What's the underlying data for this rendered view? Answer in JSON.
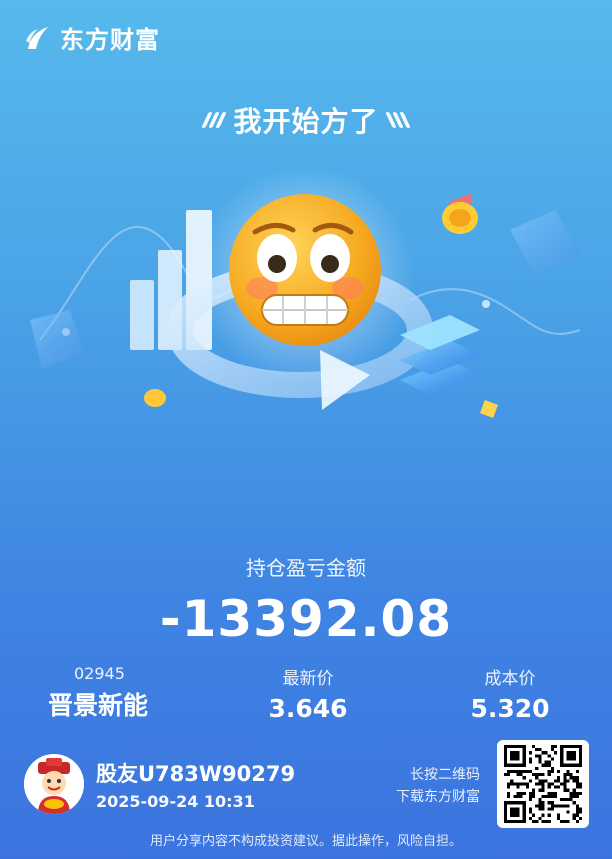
{
  "brand": {
    "name": "东方财富"
  },
  "headline": "我开始方了",
  "illustration": {
    "icon": "grimacing-emoji-icon"
  },
  "summary": {
    "label": "持仓盈亏金额",
    "amount": "-13392.08"
  },
  "stock": {
    "code": "02945",
    "name": "晋景新能",
    "latest_label": "最新价",
    "latest_value": "3.646",
    "cost_label": "成本价",
    "cost_value": "5.320"
  },
  "user": {
    "name": "股友U783W90279",
    "datetime": "2025-09-24 10:31"
  },
  "qr": {
    "hint_line1": "长按二维码",
    "hint_line2": "下载东方财富"
  },
  "disclaimer": "用户分享内容不构成投资建议。据此操作，风险自担。",
  "colors": {
    "bg_top": "#56b9ec",
    "bg_bottom": "#3b74df",
    "emoji": "#f5b324"
  }
}
